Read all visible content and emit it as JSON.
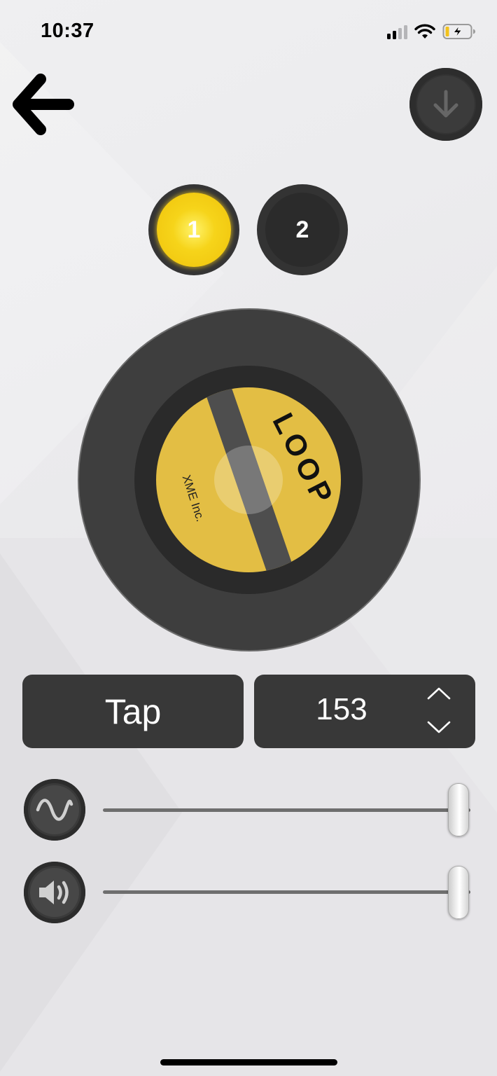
{
  "status_bar": {
    "time": "10:37",
    "icons": [
      "cellular-signal-icon",
      "wifi-icon",
      "battery-charging-icon"
    ]
  },
  "header": {
    "back_icon": "arrow-left-icon",
    "download_icon": "arrow-down-icon"
  },
  "presets": [
    {
      "label": "1",
      "selected": true
    },
    {
      "label": "2",
      "selected": false
    }
  ],
  "dial": {
    "title": "LOOP",
    "maker": "XME Inc.",
    "colors": {
      "disc": "#e3be44",
      "body": "#3e3e3e"
    }
  },
  "controls": {
    "tap_label": "Tap",
    "bpm_value": "153",
    "bpm_up_icon": "chevron-up-icon",
    "bpm_down_icon": "chevron-down-icon"
  },
  "sliders": [
    {
      "icon": "sine-wave-icon",
      "level": 1.0
    },
    {
      "icon": "speaker-volume-icon",
      "level": 1.0
    }
  ],
  "accent_colors": {
    "preset_active": "#f6d41a",
    "dark": "#383838"
  }
}
